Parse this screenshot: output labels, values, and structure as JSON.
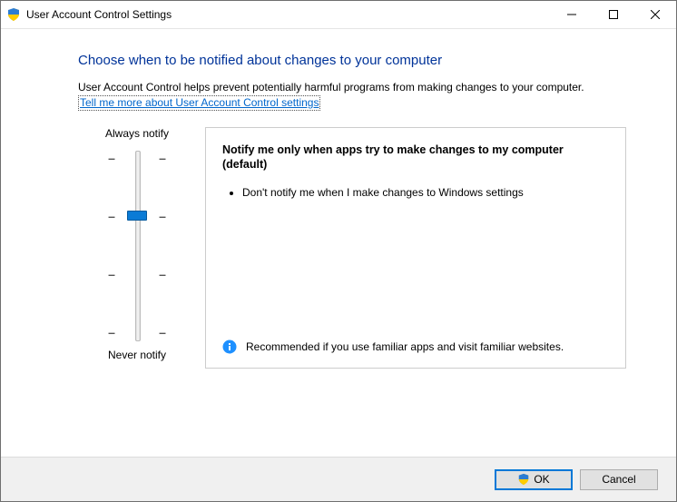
{
  "titlebar": {
    "title": "User Account Control Settings"
  },
  "content": {
    "heading": "Choose when to be notified about changes to your computer",
    "description": "User Account Control helps prevent potentially harmful programs from making changes to your computer.",
    "link": "Tell me more about User Account Control settings"
  },
  "slider": {
    "top_label": "Always notify",
    "bottom_label": "Never notify",
    "levels": 4,
    "current_level": 2
  },
  "panel": {
    "title": "Notify me only when apps try to make changes to my computer (default)",
    "bullets": [
      "Don't notify me when I make changes to Windows settings"
    ],
    "recommendation": "Recommended if you use familiar apps and visit familiar websites."
  },
  "footer": {
    "ok_label": "OK",
    "cancel_label": "Cancel"
  }
}
